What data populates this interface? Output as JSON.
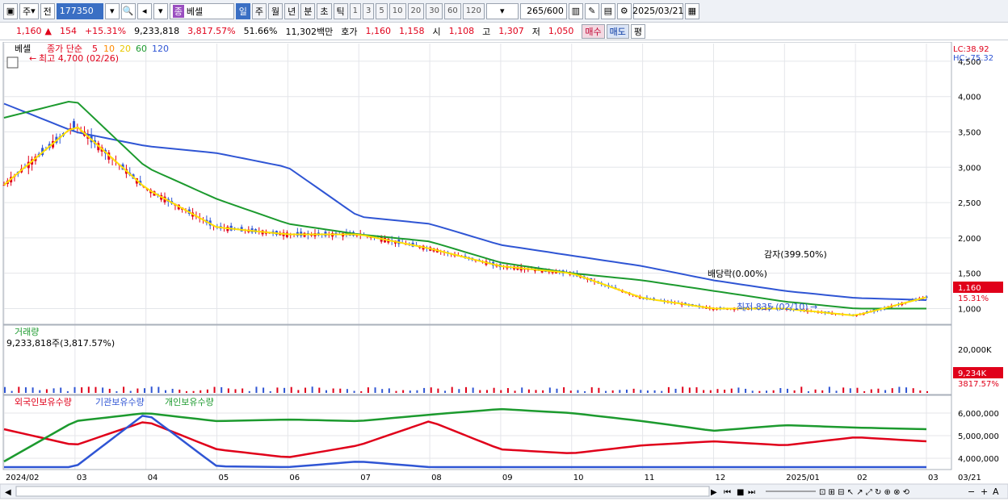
{
  "toolbar": {
    "market": "주",
    "scope": "전",
    "code": "177350",
    "stock_name": "베셀",
    "stock_badge": "종",
    "periods": [
      "일",
      "주",
      "월",
      "년",
      "분",
      "초",
      "틱"
    ],
    "active_period": "일",
    "intervals": [
      "1",
      "3",
      "5",
      "10",
      "20",
      "30",
      "60",
      "120"
    ],
    "count": "265",
    "count_total": "/600",
    "date": "2025/03/21"
  },
  "quote": {
    "price": "1,160",
    "change": "154",
    "change_pct": "+15.31%",
    "volume": "9,233,818",
    "volume_pct": "3,817.57%",
    "turnover_pct": "51.66%",
    "amount": "11,302백만",
    "bid_label": "호가",
    "ask": "1,160",
    "bid": "1,158",
    "open_label": "시",
    "open": "1,108",
    "high_label": "고",
    "high": "1,307",
    "low_label": "저",
    "low": "1,050",
    "buy_label": "매수",
    "sell_label": "매도",
    "avg_label": "평"
  },
  "price_panel": {
    "name": "베셀",
    "ma_label": "종가 단순",
    "ma_periods": [
      "5",
      "10",
      "20",
      "60",
      "120"
    ],
    "ma_colors": [
      "#e0001a",
      "#ff8a00",
      "#ffe000",
      "#1c9a2e",
      "#2f55d4"
    ],
    "high_note": "최고 4,700 (02/26)",
    "low_note": "최저 835 (02/10)",
    "div_note": "배당락(0.00%)",
    "cap_note": "감자(399.50%)",
    "lc": "LC:38.92",
    "hc": "HC:-75.32",
    "price_tag": "1,160",
    "pct_tag": "15.31%",
    "y_ticks": [
      "4,500",
      "4,000",
      "3,500",
      "3,000",
      "2,500",
      "2,000",
      "1,500",
      "1,000"
    ]
  },
  "volume_panel": {
    "title": "거래량",
    "value": "9,233,818주(3,817.57%)",
    "y_tick": "20,000K",
    "tag": "9,234K",
    "tag_pct": "3817.57%"
  },
  "holding_panel": {
    "series": [
      "외국인보유수량",
      "기관보유수량",
      "개인보유수량"
    ],
    "series_colors": [
      "#e0001a",
      "#2f55d4",
      "#1c9a2e"
    ],
    "y_ticks": [
      "6,000,000",
      "5,000,000",
      "4,000,000"
    ]
  },
  "x_labels": [
    "2024/02",
    "03",
    "04",
    "05",
    "06",
    "07",
    "08",
    "09",
    "10",
    "11",
    "12",
    "2025/01",
    "02",
    "03"
  ],
  "x_end": "03/21",
  "chart_data": {
    "type": "line",
    "title": "베셀",
    "series": [
      {
        "name": "종가",
        "x": [
          "2024/02",
          "2024/03",
          "2024/04",
          "2024/05",
          "2024/06",
          "2024/07",
          "2024/08",
          "2024/09",
          "2024/10",
          "2024/11",
          "2024/12",
          "2025/01",
          "2025/02",
          "2025/03"
        ],
        "values": [
          2750,
          3600,
          2700,
          2150,
          2050,
          2050,
          1850,
          1600,
          1500,
          1150,
          1000,
          1000,
          900,
          1160
        ]
      },
      {
        "name": "120",
        "x": [
          "2024/02",
          "2024/03",
          "2024/04",
          "2024/05",
          "2024/06",
          "2024/07",
          "2024/08",
          "2024/09",
          "2024/10",
          "2024/11",
          "2024/12",
          "2025/01",
          "2025/02",
          "2025/03"
        ],
        "values": [
          3900,
          3500,
          3300,
          3200,
          3000,
          2300,
          2200,
          1900,
          1750,
          1600,
          1400,
          1250,
          1150,
          1120
        ]
      },
      {
        "name": "60",
        "x": [
          "2024/02",
          "2024/03",
          "2024/04",
          "2024/05",
          "2024/06",
          "2024/07",
          "2024/08",
          "2024/09",
          "2024/10",
          "2024/11",
          "2024/12",
          "2025/01",
          "2025/02",
          "2025/03"
        ],
        "values": [
          3700,
          3950,
          3000,
          2550,
          2200,
          2050,
          1950,
          1650,
          1500,
          1400,
          1250,
          1100,
          1000,
          1000
        ]
      }
    ],
    "ylim": [
      800,
      4750
    ]
  }
}
